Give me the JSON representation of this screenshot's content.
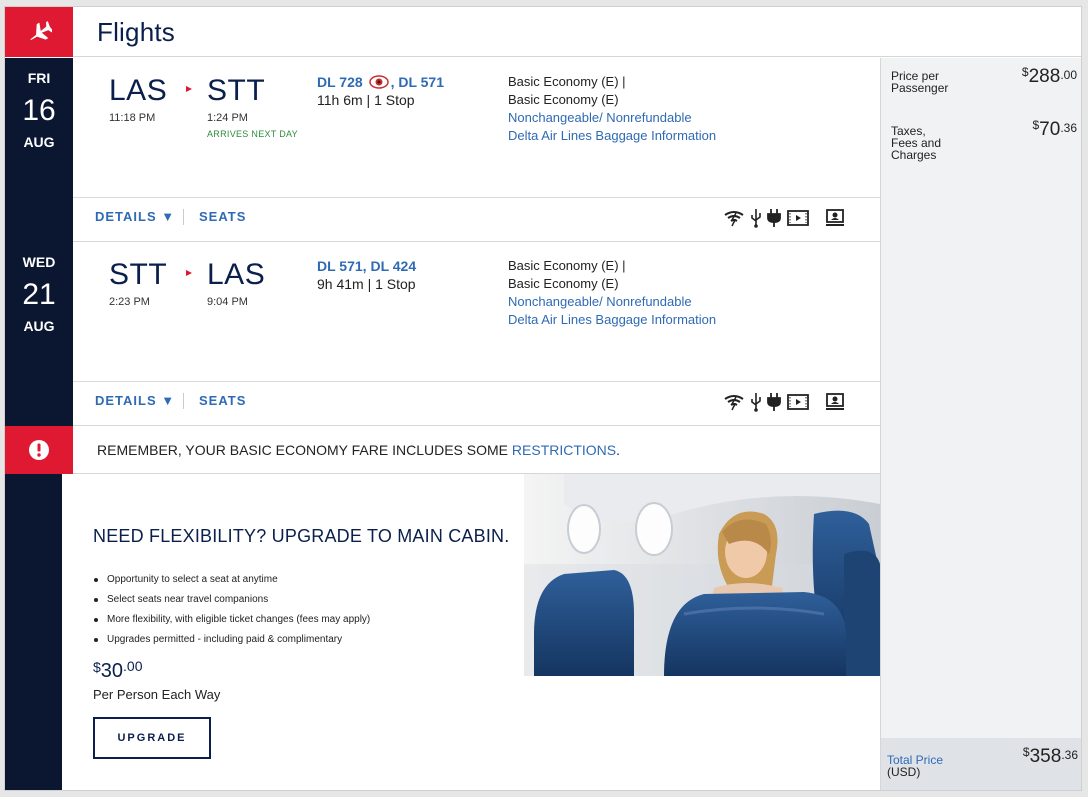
{
  "header": {
    "title": "Flights",
    "icon": "plane-icon"
  },
  "legs": [
    {
      "dow": "FRI",
      "day": "16",
      "month": "AUG",
      "origin": "LAS",
      "origin_time": "11:18 PM",
      "dest": "STT",
      "dest_time": "1:24 PM",
      "arrives_note": "ARRIVES NEXT DAY",
      "flight_1": "DL 728",
      "flight_2": "DL 571",
      "duration": "11h 6m | 1 Stop",
      "fare_1": "Basic Economy (E) |",
      "fare_2": "Basic Economy (E)",
      "policy": "Nonchangeable/ Nonrefundable",
      "baggage": "Delta Air Lines Baggage Information",
      "details": "DETAILS ▼",
      "seats": "SEATS"
    },
    {
      "dow": "WED",
      "day": "21",
      "month": "AUG",
      "origin": "STT",
      "origin_time": "2:23 PM",
      "dest": "LAS",
      "dest_time": "9:04 PM",
      "flight_1": "DL 571",
      "flight_2": "DL 424",
      "duration": "9h 41m | 1 Stop",
      "fare_1": "Basic Economy (E) |",
      "fare_2": "Basic Economy (E)",
      "policy": "Nonchangeable/ Nonrefundable",
      "baggage": "Delta Air Lines Baggage Information",
      "details": "DETAILS ▼",
      "seats": "SEATS"
    }
  ],
  "restriction": {
    "text": "REMEMBER, YOUR BASIC ECONOMY FARE INCLUDES SOME ",
    "link": "RESTRICTIONS",
    "end": "."
  },
  "promo": {
    "headline": "NEED FLEXIBILITY? UPGRADE TO MAIN CABIN.",
    "bullets": [
      "Opportunity to select a seat at anytime",
      "Select seats near travel companions",
      "More flexibility, with eligible ticket changes (fees may apply)",
      "Upgrades permitted - including paid & complimentary"
    ],
    "price_symbol": "$",
    "price_whole": "30",
    "price_cents": ".00",
    "per": "Per Person Each Way",
    "button": "UPGRADE"
  },
  "summary": {
    "price_per_label_1": "Price per",
    "price_per_label_2": "Passenger",
    "price_per_symbol": "$",
    "price_per_whole": "288",
    "price_per_cents": ".00",
    "taxes_label_1": "Taxes,",
    "taxes_label_2": "Fees and",
    "taxes_label_3": "Charges",
    "taxes_symbol": "$",
    "taxes_whole": "70",
    "taxes_cents": ".36",
    "total_label": "Total Price",
    "total_currency": "(USD)",
    "total_symbol": "$",
    "total_whole": "358",
    "total_cents": ".36"
  },
  "colors": {
    "navy": "#0b1630",
    "red": "#e01933",
    "link": "#2f6ab4"
  }
}
